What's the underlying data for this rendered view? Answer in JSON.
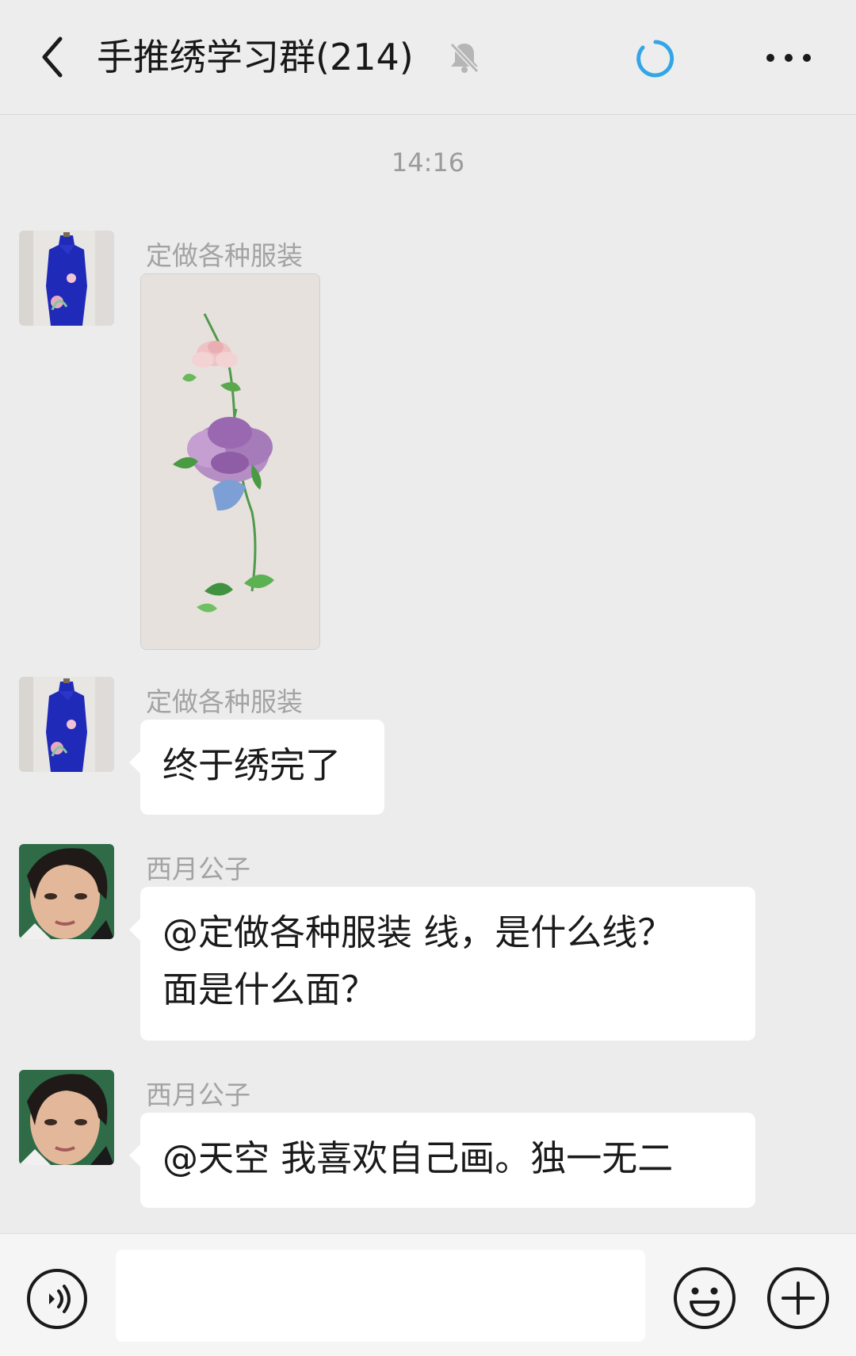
{
  "header": {
    "title": "手推绣学习群(214)",
    "icons": {
      "back": "chevron-left-icon",
      "mute": "bell-off-icon",
      "loading": "loading-spinner-icon",
      "more": "more-dots-icon"
    }
  },
  "chat": {
    "timestamp": "14:16",
    "messages": [
      {
        "sender": "定做各种服装",
        "type": "image",
        "image": "embroidered peony on fabric"
      },
      {
        "sender": "定做各种服装",
        "type": "text",
        "text": "终于绣完了"
      },
      {
        "sender": "西月公子",
        "type": "text",
        "line1": "@定做各种服装  线，是什么线？",
        "line2": "面是什么面？"
      },
      {
        "sender": "西月公子",
        "type": "text",
        "text": "@天空  我喜欢自己画。独一无二"
      }
    ]
  },
  "input_bar": {
    "value": "",
    "icons": {
      "voice": "voice-icon",
      "emoji": "emoji-icon",
      "plus": "plus-icon"
    }
  },
  "colors": {
    "background": "#ececec",
    "bubble": "#ffffff",
    "spinner": "#33a6e8",
    "secondary_text": "#a3a3a3"
  }
}
